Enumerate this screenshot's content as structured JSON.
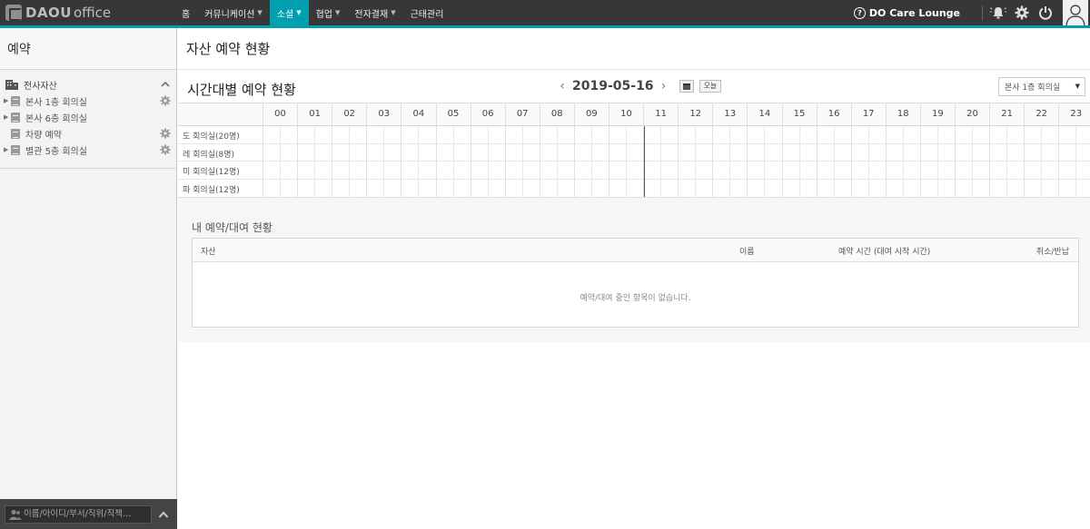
{
  "app": {
    "logo_brand": "DAOU",
    "logo_product": "office"
  },
  "nav": {
    "items": [
      {
        "label": "홈",
        "caret": false,
        "active": false
      },
      {
        "label": "커뮤니케이션",
        "caret": true,
        "active": false
      },
      {
        "label": "소셜",
        "caret": true,
        "active": true
      },
      {
        "label": "협업",
        "caret": true,
        "active": false
      },
      {
        "label": "전자결재",
        "caret": true,
        "active": false
      },
      {
        "label": "근태관리",
        "caret": false,
        "active": false
      }
    ],
    "care_lounge": "DO Care Lounge"
  },
  "icons": {
    "help": "help-circle-icon",
    "alarm": "bell-alarm-icon",
    "settings": "gear-icon",
    "logout": "power-icon",
    "avatar": "user-avatar-icon"
  },
  "colors": {
    "accent": "#00a0b0",
    "topbar": "#373737"
  },
  "sidebar": {
    "title": "예약",
    "root_label": "전사자산",
    "items": [
      {
        "label": "본사 1층 회의실",
        "expandable": true,
        "settings": true
      },
      {
        "label": "본사 6층 회의실",
        "expandable": true,
        "settings": false
      },
      {
        "label": "차량 예약",
        "expandable": false,
        "settings": true
      },
      {
        "label": "별관 5층 회의실",
        "expandable": true,
        "settings": true
      }
    ],
    "search_placeholder": "이름/아이디/부서/직위/직책…"
  },
  "main": {
    "page_title": "자산 예약 현황",
    "section_title": "시간대별 예약 현황",
    "date": "2019-05-16",
    "today_label": "오늘",
    "room_select": "본사 1층 회의실",
    "hours": [
      "00",
      "01",
      "02",
      "03",
      "04",
      "05",
      "06",
      "07",
      "08",
      "09",
      "10",
      "11",
      "12",
      "13",
      "14",
      "15",
      "16",
      "17",
      "18",
      "19",
      "20",
      "21",
      "22",
      "23"
    ],
    "current_time_hour": 11,
    "rooms": [
      "도 회의실(20명)",
      "레 회의실(8명)",
      "미 회의실(12명)",
      "파 회의실(12명)"
    ]
  },
  "reservations": {
    "title": "내 예약/대여 현황",
    "columns": {
      "asset": "자산",
      "name": "이름",
      "time": "예약 시간 (대여 시작 시간)",
      "action": "취소/반납"
    },
    "empty_message": "예약/대여 중인 항목이 없습니다."
  }
}
